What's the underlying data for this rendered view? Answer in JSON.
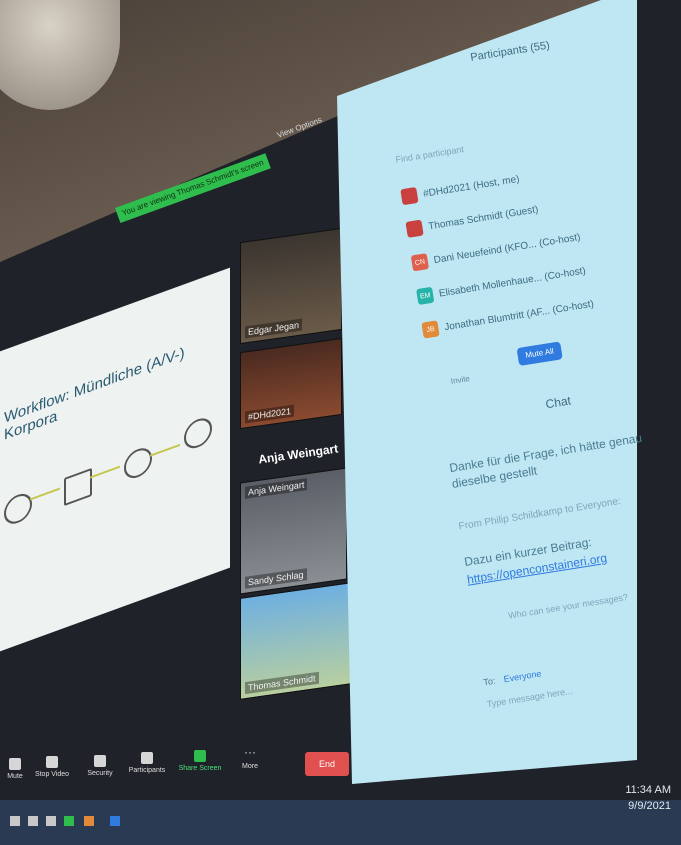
{
  "meeting": {
    "banner": "You are viewing Thomas Schmidt's screen",
    "view_options": "View Options",
    "view_label": "View"
  },
  "slide": {
    "title": "Workflow: Mündliche (A/V-) Korpora"
  },
  "videos": [
    {
      "name": "Edgar Jegan"
    },
    {
      "name": "#DHd2021"
    },
    {
      "name": "Anja Weingart",
      "speaking_label": "Anja Weingart"
    },
    {
      "name": "Sandy Schlag"
    },
    {
      "name": "Thomas Schmidt"
    }
  ],
  "participants": {
    "header": "Participants (55)",
    "search_placeholder": "Find a participant",
    "rows": [
      {
        "initials": "",
        "name": "#DHd2021 (Host, me)",
        "color": "#c9413f"
      },
      {
        "initials": "",
        "name": "Thomas Schmidt (Guest)",
        "color": "#c9413f"
      },
      {
        "initials": "CN",
        "name": "Dani Neuefeind (KFO... (Co-host)",
        "color": "#e0604e"
      },
      {
        "initials": "EM",
        "name": "Elisabeth Mollenhaue... (Co-host)",
        "color": "#26b3a8"
      },
      {
        "initials": "JB",
        "name": "Jonathan Blumtritt (AF... (Co-host)",
        "color": "#e08a3a"
      }
    ],
    "invite_label": "Invite",
    "mute_all_label": "Mute All"
  },
  "chat": {
    "header": "Chat",
    "messages": [
      {
        "text": "Danke für die Frage, ich hätte genau dieselbe gestellt"
      },
      {
        "text": "From Philip Schildkamp to Everyone:"
      },
      {
        "text": "Dazu ein kurzer Beitrag:",
        "link": "https://openconstaineri.org"
      }
    ],
    "who_can_see": "Who can see your messages?",
    "to_label": "To:",
    "to_value": "Everyone",
    "input_placeholder": "Type message here..."
  },
  "toolbar": {
    "items": [
      {
        "label": "Mute",
        "icon": "microphone-icon"
      },
      {
        "label": "Stop Video",
        "icon": "video-icon"
      },
      {
        "label": "Security",
        "icon": "shield-icon"
      },
      {
        "label": "Participants",
        "icon": "people-icon",
        "count": "55"
      },
      {
        "label": "Share Screen",
        "icon": "share-icon"
      },
      {
        "label": "More",
        "icon": "more-icon"
      }
    ],
    "end_label": "End"
  },
  "taskbar": {
    "time": "11:34 AM",
    "date": "9/9/2021"
  },
  "colors": {
    "panel_bg": "#bfe6f3",
    "banner_green": "#2fbe4e",
    "end_red": "#e0504e",
    "accent_blue": "#2f7be0"
  }
}
